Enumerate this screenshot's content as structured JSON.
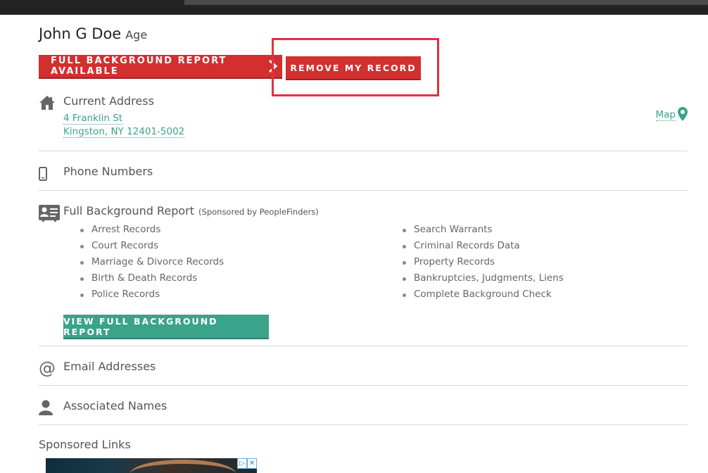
{
  "person": {
    "name": "John G Doe",
    "age_label": "Age"
  },
  "actions": {
    "full_report_label": "FULL BACKGROUND REPORT AVAILABLE",
    "remove_record_label": "REMOVE MY RECORD"
  },
  "address": {
    "title": "Current Address",
    "line1": "4 Franklin St",
    "line2": "Kingston, NY 12401-5002",
    "map_label": "Map"
  },
  "phone": {
    "title": "Phone Numbers"
  },
  "background": {
    "title": "Full Background Report",
    "sponsor_note": "(Sponsored by PeopleFinders)",
    "left_items": [
      "Arrest Records",
      "Court Records",
      "Marriage & Divorce Records",
      "Birth & Death Records",
      "Police Records"
    ],
    "right_items": [
      "Search Warrants",
      "Criminal Records Data",
      "Property Records",
      "Bankruptcies, Judgments, Liens",
      "Complete Background Check"
    ],
    "view_button_label": "VIEW FULL BACKGROUND REPORT"
  },
  "email": {
    "title": "Email Addresses",
    "icon_glyph": "@"
  },
  "associated": {
    "title": "Associated Names"
  },
  "sponsored": {
    "title": "Sponsored Links"
  },
  "colors": {
    "red": "#d32f2f",
    "green": "#3aa389",
    "highlight": "#e03240",
    "icon_gray": "#666666"
  }
}
